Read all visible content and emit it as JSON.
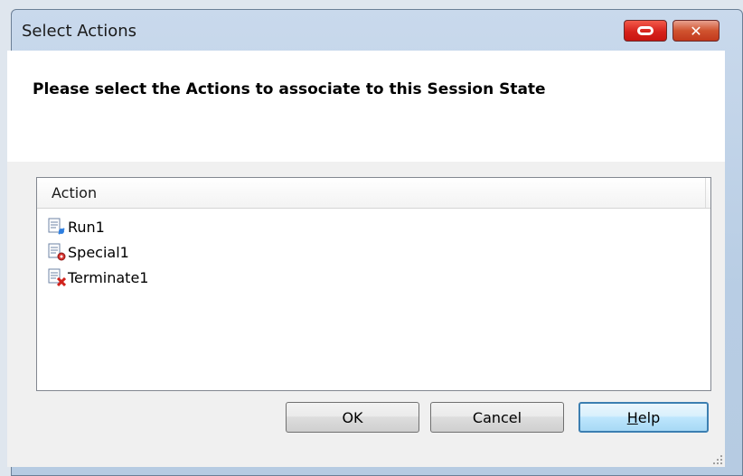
{
  "window": {
    "title": "Select Actions",
    "close_symbol": "✕"
  },
  "header": {
    "heading": "Please select the Actions to associate to this Session State"
  },
  "list": {
    "column": "Action",
    "items": [
      {
        "label": "Run1",
        "icon": "run-action-icon"
      },
      {
        "label": "Special1",
        "icon": "special-action-icon"
      },
      {
        "label": "Terminate1",
        "icon": "terminate-action-icon"
      }
    ]
  },
  "buttons": {
    "ok": "OK",
    "cancel": "Cancel",
    "help_underlined": "H",
    "help_rest": "elp"
  },
  "colors": {
    "accent_red": "#d6221c",
    "focus_blue": "#3c7fb1"
  }
}
